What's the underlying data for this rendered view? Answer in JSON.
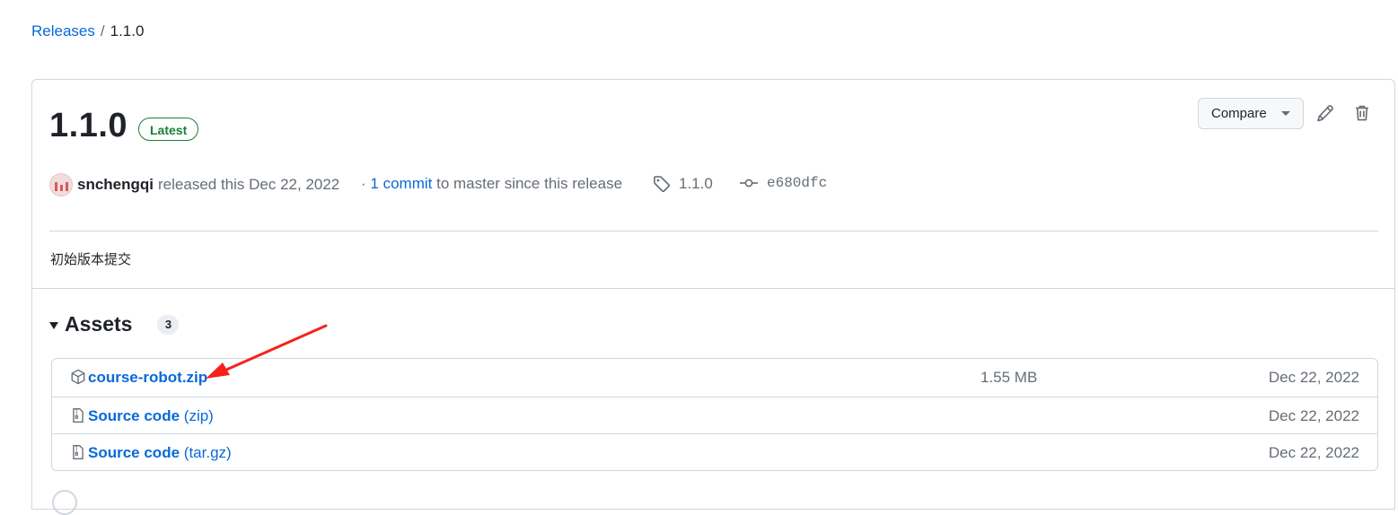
{
  "breadcrumb": {
    "root": "Releases",
    "separator": "/",
    "current": "1.1.0"
  },
  "release": {
    "title": "1.1.0",
    "badge": "Latest",
    "author": "snchengqi",
    "released_text": "released this Dec 22, 2022",
    "commit_prefix": "·",
    "commit_link": "1 commit",
    "commit_suffix": "to master since this release",
    "tag": "1.1.0",
    "sha": "e680dfc",
    "notes": "初始版本提交"
  },
  "toolbar": {
    "compare_label": "Compare",
    "edit_icon": "pencil-icon",
    "delete_icon": "trash-icon"
  },
  "assets": {
    "heading": "Assets",
    "count": "3",
    "rows": [
      {
        "icon": "package-icon",
        "name": "course-robot.zip",
        "suffix": "",
        "size": "1.55 MB",
        "date": "Dec 22, 2022"
      },
      {
        "icon": "file-zip-icon",
        "name": "Source code",
        "suffix": "(zip)",
        "size": "",
        "date": "Dec 22, 2022"
      },
      {
        "icon": "file-zip-icon",
        "name": "Source code",
        "suffix": "(tar.gz)",
        "size": "",
        "date": "Dec 22, 2022"
      }
    ]
  },
  "colors": {
    "link": "#0969da",
    "latest_green": "#1a7f37",
    "annotation_arrow": "#f5221b",
    "border": "#d0d7de"
  }
}
